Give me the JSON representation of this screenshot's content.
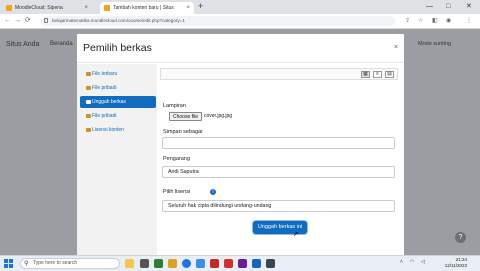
{
  "browser": {
    "tabs": [
      {
        "label": "MoodleCloud: Sipena"
      },
      {
        "label": "Tambah konten baru | Situs"
      },
      {
        "label": "Situs Anda"
      }
    ],
    "new_tab": "+",
    "url": "belajarmatematika.moodlecloud.com/course/edit.php?category=1",
    "nav_back": "←",
    "nav_forward": "→",
    "nav_reload": "⟳",
    "window_controls": [
      "—",
      "□",
      "✕"
    ]
  },
  "site": {
    "brand": "Situs Anda",
    "beranda": "Beranda",
    "user": "Mode sunting",
    "help": "?"
  },
  "modal": {
    "title": "Pemilih berkas",
    "close": "×",
    "sidebar": [
      {
        "label": "File terbaru"
      },
      {
        "label": "File pribadi"
      },
      {
        "label": "Unggah berkas",
        "active": true
      },
      {
        "label": "File pribadi"
      },
      {
        "label": "Lisensi konten"
      }
    ],
    "view_buttons": [
      "▦",
      "≡",
      "▤"
    ],
    "lampiran_label": "Lampiran",
    "choose_file": "Choose file",
    "chosen_file": "cover.jpg.jpg",
    "simpan_label": "Simpan sebagai",
    "simpan_value": "",
    "pengarang_label": "Pengarang",
    "pengarang_value": "Andi Saputra",
    "pilih_label": "Pilih lisensi",
    "lisensi_value": "Seluruh hak cipta dilindungi undang-undang",
    "upload_button": "Unggah berkas ini"
  },
  "taskbar": {
    "search_placeholder": "Type here to search",
    "time": "21:24",
    "date": "12/11/2023"
  }
}
